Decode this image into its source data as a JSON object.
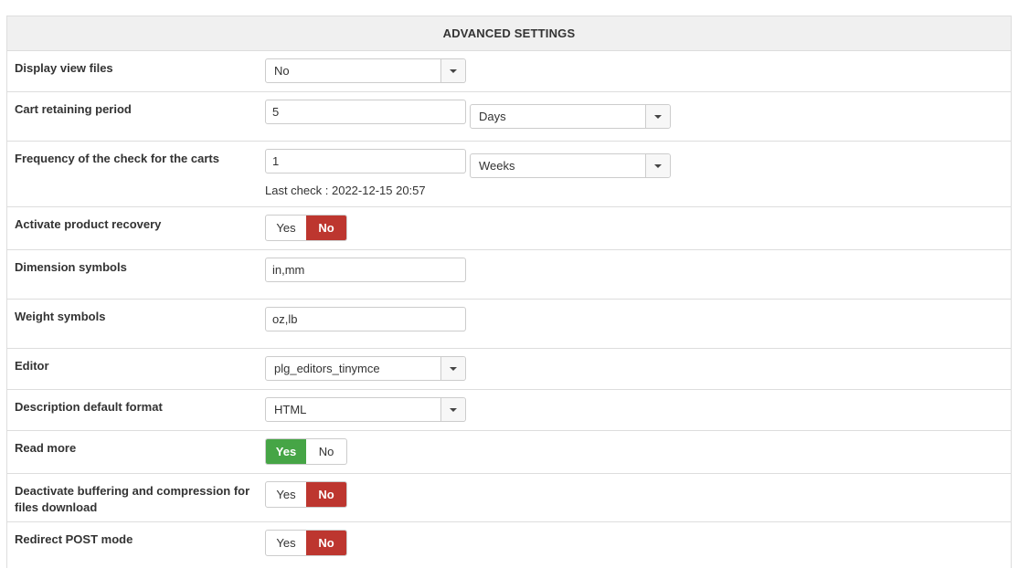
{
  "panel": {
    "title": "ADVANCED SETTINGS"
  },
  "rows": {
    "display_view_files": {
      "label": "Display view files",
      "value": "No"
    },
    "cart_retaining_period": {
      "label": "Cart retaining period",
      "value": "5",
      "unit": "Days"
    },
    "check_frequency": {
      "label": "Frequency of the check for the carts",
      "value": "1",
      "unit": "Weeks",
      "last_check": "Last check : 2022-12-15 20:57"
    },
    "activate_product_recovery": {
      "label": "Activate product recovery",
      "yes": "Yes",
      "no": "No",
      "selected": "No"
    },
    "dimension_symbols": {
      "label": "Dimension symbols",
      "value": "in,mm"
    },
    "weight_symbols": {
      "label": "Weight symbols",
      "value": "oz,lb"
    },
    "editor": {
      "label": "Editor",
      "value": "plg_editors_tinymce"
    },
    "description_format": {
      "label": "Description default format",
      "value": "HTML"
    },
    "read_more": {
      "label": "Read more",
      "yes": "Yes",
      "no": "No",
      "selected": "Yes"
    },
    "deactivate_buffering": {
      "label": "Deactivate buffering and compression for files download",
      "yes": "Yes",
      "no": "No",
      "selected": "No"
    },
    "redirect_post_mode": {
      "label": "Redirect POST mode",
      "yes": "Yes",
      "no": "No",
      "selected": "No"
    }
  },
  "icons": {
    "dropdown": "chevron-down-icon"
  },
  "colors": {
    "toggle_no_active": "#bd362f",
    "toggle_yes_active": "#46a546",
    "header_bg": "#f0f0f0",
    "border": "#dddddd"
  }
}
